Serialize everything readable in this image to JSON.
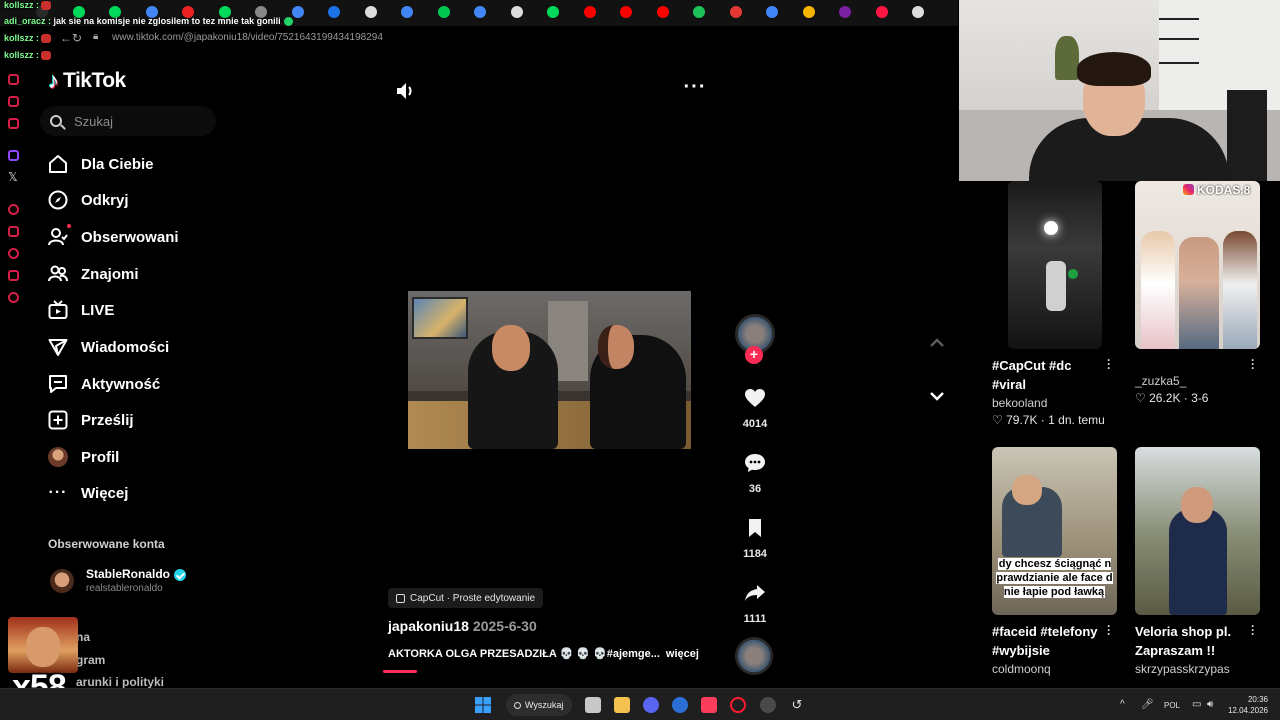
{
  "browser": {
    "url": "www.tiktok.com/@japakoniu18/video/7521643199434198294",
    "tab_icon_colors": [
      "#2a2a2a",
      "#00d95a",
      "#00d95a",
      "#4285f4",
      "#e22",
      "#00d95a",
      "#888",
      "#4285f4",
      "#1a73e8",
      "#ddd",
      "#4285f4",
      "#00c853",
      "#4285f4",
      "#ddd",
      "#00d95a",
      "#ff0000",
      "#ff0000",
      "#ff0000",
      "#1ec25b",
      "#e53935",
      "#4285f4",
      "#f4b400",
      "#7b1fa2",
      "#ff1744",
      "#ddd"
    ]
  },
  "chat": [
    {
      "user": "kollszz :",
      "text": ""
    },
    {
      "user": "adi_oracz :",
      "text": "jak sie na komisje nie zglosilem to tez mnie tak gonili"
    },
    {
      "user": "kollszz :",
      "text": ""
    },
    {
      "user": "kollszz :",
      "text": ""
    }
  ],
  "tiktok": {
    "logo": "TikTok",
    "search_placeholder": "Szukaj",
    "nav": [
      {
        "label": "Dla Ciebie",
        "icon": "home-icon"
      },
      {
        "label": "Odkryj",
        "icon": "compass-icon"
      },
      {
        "label": "Obserwowani",
        "icon": "following-icon"
      },
      {
        "label": "Znajomi",
        "icon": "friends-icon"
      },
      {
        "label": "LIVE",
        "icon": "live-icon"
      },
      {
        "label": "Wiadomości",
        "icon": "messages-icon"
      },
      {
        "label": "Aktywność",
        "icon": "activity-icon"
      },
      {
        "label": "Prześlij",
        "icon": "upload-icon"
      },
      {
        "label": "Profil",
        "icon": "profile-avatar"
      },
      {
        "label": "Więcej",
        "icon": "more-icon"
      }
    ],
    "followed_header": "Obserwowane konta",
    "followed": [
      {
        "name": "StableRonaldo",
        "handle": "realstableronaldo",
        "verified": true
      }
    ],
    "footer_links": [
      "na",
      "gram",
      "arunki i polityki"
    ]
  },
  "overlay": {
    "emote_count": "x58"
  },
  "video": {
    "effect": "CapCut · Proste edytowanie",
    "author": "japakoniu18",
    "date": "2025-6-30",
    "description": "AKTORKA OLGA PRZESADZIŁA 💀 💀 💀#ajemge...",
    "more_label": "więcej",
    "progress_fraction": 0.06,
    "likes": "4014",
    "comments": "36",
    "saves": "1184",
    "shares": "1111"
  },
  "recommendations": [
    {
      "title": "#CapCut #dc #viral",
      "user": "bekooland",
      "likes": "79.7K",
      "age": "1 dn. temu",
      "overlay": ""
    },
    {
      "title": "",
      "user": "_zuzka5_",
      "likes": "26.2K",
      "age": "3-6",
      "overlay": "KODAS.8"
    },
    {
      "title": "#faceid #telefony #wybijsie",
      "user": "coldmoonq",
      "likes": "",
      "age": "",
      "overlay": "dy chcesz ściągnąć n prawdzianie ale face d nie łapie pod ławką"
    },
    {
      "title": "Veloria shop pl. Zapraszam !!",
      "user": "skrzypasskrzypas",
      "likes": "",
      "age": "",
      "overlay": ""
    }
  ],
  "taskbar": {
    "search_label": "Wyszukaj",
    "lang": "POL",
    "time": "20:36",
    "date": "12.04.2026"
  },
  "colors": {
    "accent": "#fe2c55",
    "background": "#000000",
    "verified": "#20d5ec"
  }
}
